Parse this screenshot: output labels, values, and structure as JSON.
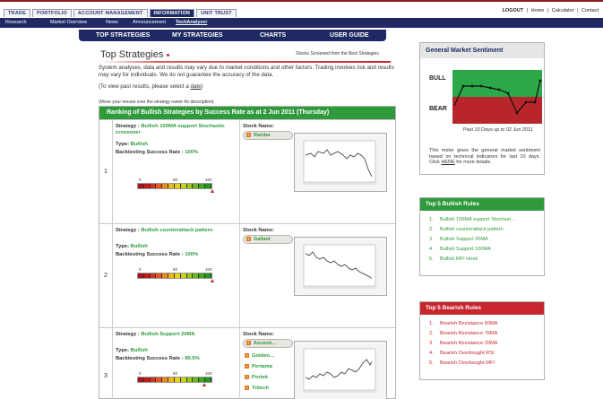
{
  "tabs": [
    "TRADE",
    "PORTFOLIO",
    "ACCOUNT MANAGEMENT",
    "INFORMATION",
    "UNIT TRUST"
  ],
  "toplinks": {
    "logout": "LOGOUT",
    "home": "Home",
    "calculator": "Calculator",
    "contact": "Contact",
    "sep": "|"
  },
  "subnav": [
    "Research",
    "Market Overview",
    "News",
    "Announcement",
    "TechAnalyzer"
  ],
  "menu": [
    "TOP STRATEGIES",
    "MY STRATEGIES",
    "CHARTS",
    "USER GUIDE"
  ],
  "page": {
    "title": "Top Strategies",
    "screened": "Stocks Screened from the Best Strategies",
    "disclaimer": "System analyses, data and results may vary due to market conditions and other factors. Trading involves risk and results may vary for individuals. We do not guarantee the accuracy of the data.",
    "past_prefix": "(To view past results, please select a ",
    "past_link": "date",
    "past_suffix": ")",
    "hint": "(Move your mouse over the strategy name for description)"
  },
  "ranking": {
    "header": "Ranking of Bullish Strategies by Success Rate as at 2 Jun 2011 (Thursday)",
    "strategy_label": "Strategy : ",
    "type_label": "Type: ",
    "backtest_label": "Backtesting Success Rate : ",
    "stock_label": "Stock Name:",
    "gauge_ticks": [
      "0",
      "50",
      "100"
    ],
    "rows": [
      {
        "rank": "1",
        "strategy": "Bullish 100MA support Stochastic crossover",
        "type": "Bullish",
        "rate": "100%",
        "rate_value": 1.0,
        "stocks": [
          "Ramba"
        ]
      },
      {
        "rank": "2",
        "strategy": "Bullish counterattack pattern",
        "type": "Bullish",
        "rate": "100%",
        "rate_value": 1.0,
        "stocks": [
          "Gallant"
        ]
      },
      {
        "rank": "3",
        "strategy": "Bullish Support 20MA",
        "type": "Bullish",
        "rate": "89.5%",
        "rate_value": 0.895,
        "stocks": [
          "Ascend...",
          "Golden...",
          "Pertama",
          "Portek",
          "Tritech"
        ]
      }
    ]
  },
  "sentiment": {
    "title": "General Market Sentiment",
    "bull": "BULL",
    "bear": "BEAR",
    "caption": "Past 10 Days up to 02 Jun 2011",
    "desc_prefix": "This meter gives the general market sentiment based on technical indicators for last 10 days. Click ",
    "desc_link": "HERE",
    "desc_suffix": " for more details.",
    "colors": {
      "bull": "#2aa84a",
      "bear": "#b8262c"
    }
  },
  "bullish_rules": {
    "title": "Top 5 Bullish Rules",
    "items": [
      "Bullish 100MA support Stochast...",
      "Bullish counterattack pattern",
      "Bullish Support 20MA",
      "Bullish Support 100MA",
      "Bullish MFI Hook"
    ]
  },
  "bearish_rules": {
    "title": "Top 5 Bearish Rules",
    "items": [
      "Bearish Resistance 50MA",
      "Bearish Resistance 76MA",
      "Bearish Resistance 20MA",
      "Bearish Overbought RSI",
      "Bearish Overbought MFI"
    ]
  }
}
